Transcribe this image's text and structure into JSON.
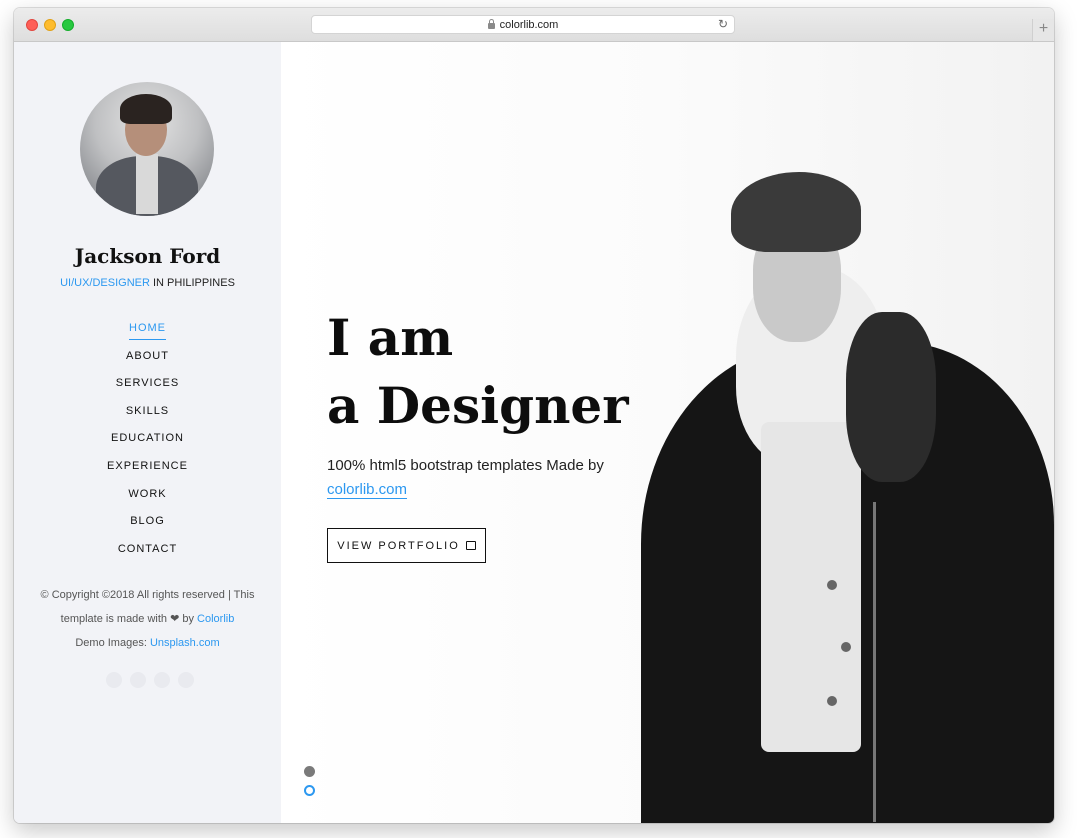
{
  "browser": {
    "url": "colorlib.com"
  },
  "sidebar": {
    "name": "Jackson Ford",
    "role_accent": "UI/UX/DESIGNER",
    "role_rest": " IN PHILIPPINES",
    "nav": [
      "HOME",
      "ABOUT",
      "SERVICES",
      "SKILLS",
      "EDUCATION",
      "EXPERIENCE",
      "WORK",
      "BLOG",
      "CONTACT"
    ],
    "active_nav": "HOME",
    "copyright": {
      "line1": "© Copyright ©2018 All rights reserved | This",
      "line2_pre": "template is made with ❤ by ",
      "line2_link": "Colorlib",
      "line3_pre": "Demo Images: ",
      "line3_link": "Unsplash.com"
    }
  },
  "hero": {
    "headline_line1": "I am",
    "headline_line2": "a Designer",
    "subtitle_pre": "100% html5 bootstrap templates Made by ",
    "subtitle_link": "colorlib.com",
    "button_label": "VIEW PORTFOLIO"
  },
  "colors": {
    "accent": "#2c98f0",
    "sidebar_bg": "#f2f3f7"
  },
  "icons": {
    "lock": "lock-icon",
    "reload": "reload-icon",
    "portfolio": "briefcase-icon",
    "heart": "heart-icon"
  }
}
